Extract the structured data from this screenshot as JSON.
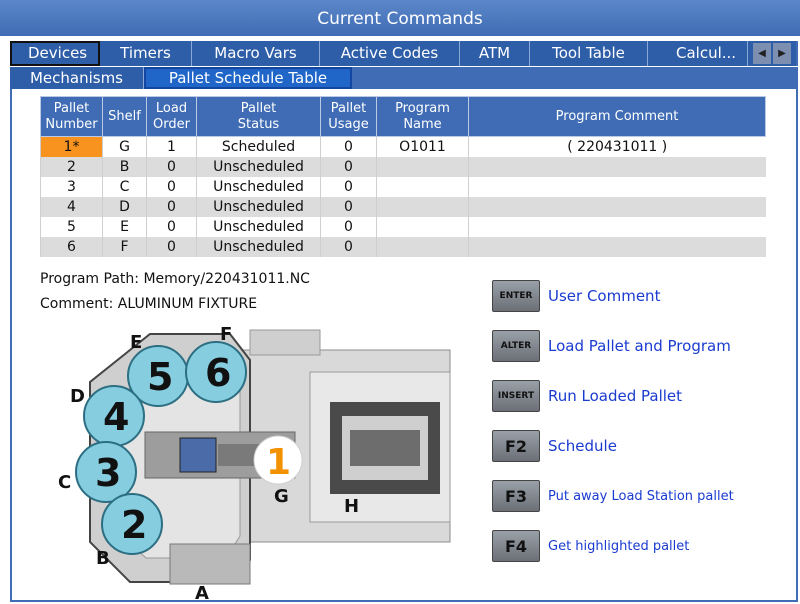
{
  "title": "Current Commands",
  "tabs": [
    "Devices",
    "Timers",
    "Macro Vars",
    "Active Codes",
    "ATM",
    "Tool Table",
    "Calcul..."
  ],
  "subtabs": [
    "Mechanisms",
    "Pallet Schedule Table"
  ],
  "table": {
    "headers": [
      [
        "Pallet",
        "Number"
      ],
      [
        "Shelf"
      ],
      [
        "Load",
        "Order"
      ],
      [
        "Pallet",
        "Status"
      ],
      [
        "Pallet",
        "Usage"
      ],
      [
        "Program",
        "Name"
      ],
      [
        "Program Comment"
      ]
    ],
    "rows": [
      [
        "1*",
        "G",
        "1",
        "Scheduled",
        "0",
        "O1011",
        "( 220431011 )"
      ],
      [
        "2",
        "B",
        "0",
        "Unscheduled",
        "0",
        "",
        ""
      ],
      [
        "3",
        "C",
        "0",
        "Unscheduled",
        "0",
        "",
        ""
      ],
      [
        "4",
        "D",
        "0",
        "Unscheduled",
        "0",
        "",
        ""
      ],
      [
        "5",
        "E",
        "0",
        "Unscheduled",
        "0",
        "",
        ""
      ],
      [
        "6",
        "F",
        "0",
        "Unscheduled",
        "0",
        "",
        ""
      ]
    ]
  },
  "program_path": "Program Path: Memory/220431011.NC",
  "comment": "Comment: ALUMINUM FIXTURE",
  "figure": {
    "shelf_letters": [
      "A",
      "B",
      "C",
      "D",
      "E",
      "F",
      "G",
      "H"
    ],
    "pallet_numbers": [
      "1",
      "2",
      "3",
      "4",
      "5",
      "6"
    ]
  },
  "commands": [
    {
      "key": "ENTER",
      "label": "User Comment"
    },
    {
      "key": "ALTER",
      "label": "Load Pallet and Program"
    },
    {
      "key": "INSERT",
      "label": "Run Loaded Pallet"
    },
    {
      "key": "F2",
      "label": "Schedule"
    },
    {
      "key": "F3",
      "label": "Put away Load Station pallet"
    },
    {
      "key": "F4",
      "label": "Get highlighted pallet"
    }
  ],
  "colors": {
    "header_blue": "#3f6cb4",
    "highlight_orange": "#f7931e",
    "pallet_cyan": "#86cde0",
    "link_blue": "#1a3bd0"
  }
}
